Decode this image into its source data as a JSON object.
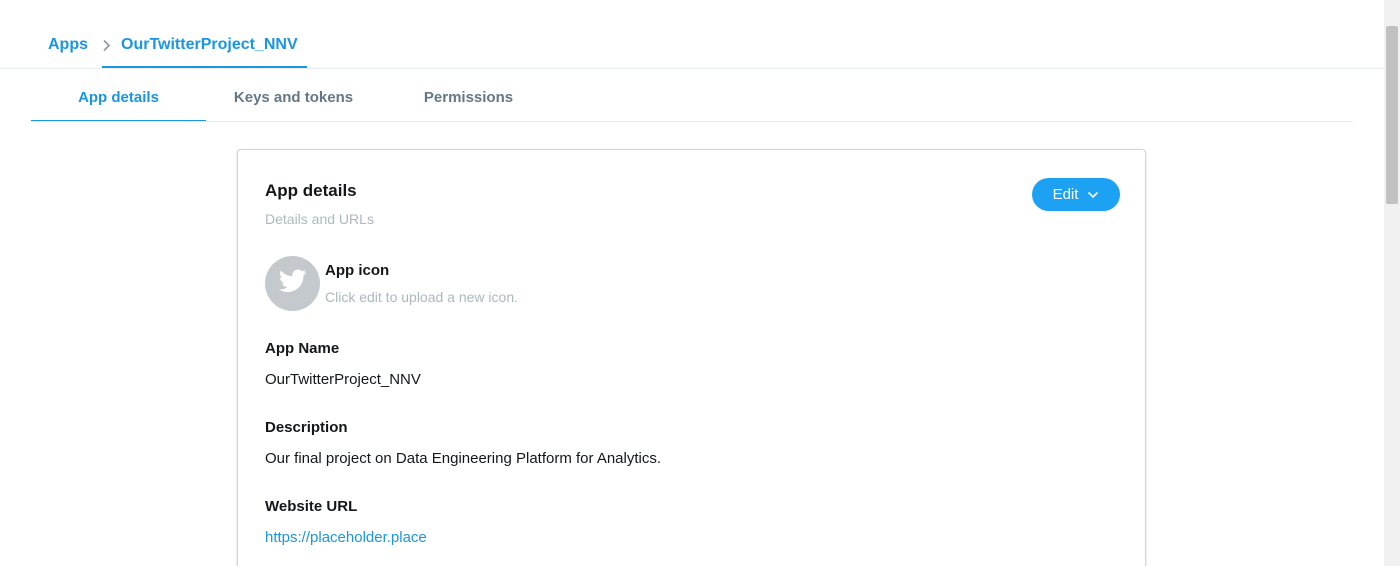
{
  "breadcrumb": {
    "root_label": "Apps",
    "current_label": "OurTwitterProject_NNV"
  },
  "tabs": [
    {
      "label": "App details",
      "active": true
    },
    {
      "label": "Keys and tokens",
      "active": false
    },
    {
      "label": "Permissions",
      "active": false
    }
  ],
  "card": {
    "title": "App details",
    "subtitle": "Details and URLs",
    "edit_label": "Edit",
    "app_icon": {
      "icon": "twitter-bird-icon",
      "label": "App icon",
      "hint": "Click edit to upload a new icon."
    },
    "fields": {
      "name": {
        "label": "App Name",
        "value": "OurTwitterProject_NNV"
      },
      "description": {
        "label": "Description",
        "value": "Our final project on Data Engineering Platform for Analytics."
      },
      "website": {
        "label": "Website URL",
        "value": "https://placeholder.place"
      }
    }
  },
  "colors": {
    "accent": "#1b95e0",
    "button": "#1da1f2",
    "muted_text": "#aab8c2",
    "tab_inactive": "#657786",
    "icon_bg": "#c4c9cd"
  }
}
